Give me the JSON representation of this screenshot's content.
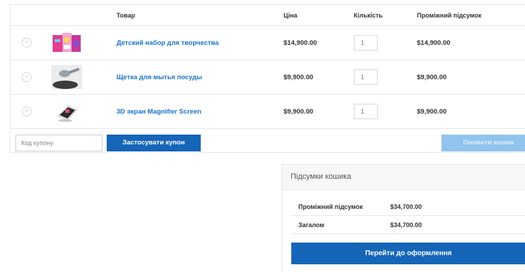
{
  "table": {
    "headers": {
      "product": "Товар",
      "price": "Ціна",
      "quantity": "Кількість",
      "subtotal": "Проміжний підсумок"
    },
    "remove_symbol": "×",
    "items": [
      {
        "name": "Детский набор для творчества",
        "price": "$14,900.00",
        "quantity": "1",
        "subtotal": "$14,900.00",
        "thumbnail_icon": "kids-craft-kit-image"
      },
      {
        "name": "Щетка для мытья посуды",
        "price": "$9,900.00",
        "quantity": "1",
        "subtotal": "$9,900.00",
        "thumbnail_icon": "dish-brush-image"
      },
      {
        "name": "3D экран Magnifier Screen",
        "price": "$9,900.00",
        "quantity": "1",
        "subtotal": "$9,900.00",
        "thumbnail_icon": "magnifier-screen-image"
      }
    ]
  },
  "coupon": {
    "placeholder": "Код купону",
    "apply_label": "Застосувати купон",
    "update_label": "Оновити кошик"
  },
  "totals": {
    "title": "Підсумки кошика",
    "subtotal_label": "Проміжний підсумок",
    "subtotal_value": "$34,700.00",
    "total_label": "Загалом",
    "total_value": "$34,700.00",
    "checkout_label": "Перейти до оформлення"
  },
  "colors": {
    "accent": "#1565b8",
    "link": "#1a73c8",
    "disabled_button": "#90c3ee"
  }
}
